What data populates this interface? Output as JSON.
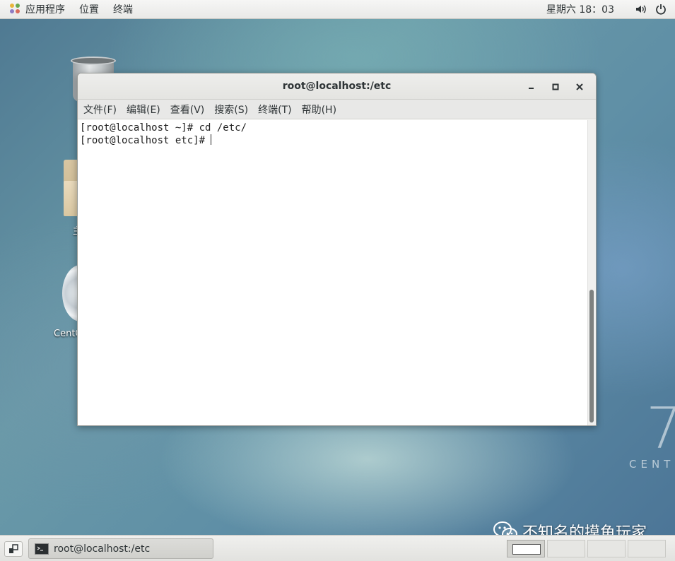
{
  "topbar": {
    "menus": [
      {
        "label": "应用程序",
        "icon": "gnome-apps-icon"
      },
      {
        "label": "位置"
      },
      {
        "label": "终端"
      }
    ],
    "clock": "星期六 18：03",
    "tray": [
      "volume-icon",
      "power-icon"
    ]
  },
  "desktop": {
    "icons": [
      {
        "name": "trash",
        "label": ""
      },
      {
        "name": "home-folder",
        "label": "主"
      },
      {
        "name": "centos-disc",
        "label": "CentO"
      }
    ],
    "watermark": {
      "number": "7",
      "text": "CENT"
    }
  },
  "window": {
    "title": "root@localhost:/etc",
    "controls": [
      "minimize-icon",
      "maximize-icon",
      "close-icon"
    ],
    "menu": [
      "文件(F)",
      "编辑(E)",
      "查看(V)",
      "搜索(S)",
      "终端(T)",
      "帮助(H)"
    ],
    "terminal": {
      "lines": [
        "[root@localhost ~]# cd /etc/",
        "[root@localhost etc]# "
      ]
    }
  },
  "taskbar": {
    "tasks": [
      {
        "label": "root@localhost:/etc",
        "icon": "terminal-icon"
      }
    ],
    "workspaces": 4,
    "active_workspace": 1
  },
  "overlay": {
    "wechat_caption": "不知名的摸鱼玩家"
  }
}
